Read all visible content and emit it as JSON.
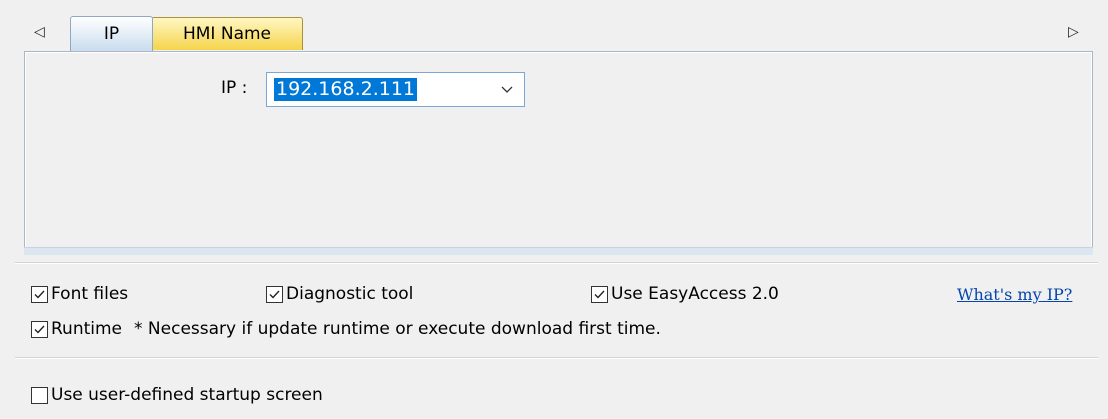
{
  "tabs": [
    {
      "label": "IP",
      "active": true
    },
    {
      "label": "HMI Name",
      "active": false
    }
  ],
  "ip": {
    "label": "IP :",
    "value": "192.168.2.111"
  },
  "options": {
    "font_files": {
      "label": "Font files",
      "checked": true
    },
    "diagnostic_tool": {
      "label": "Diagnostic tool",
      "checked": true
    },
    "easyaccess": {
      "label": "Use EasyAccess 2.0",
      "checked": true
    },
    "runtime": {
      "label": "Runtime",
      "checked": true
    },
    "runtime_note": "* Necessary if update runtime or execute download first time."
  },
  "link": {
    "label": "What's my IP?"
  },
  "startup": {
    "label": "Use user-defined startup screen",
    "checked": false
  },
  "colors": {
    "selection": "#0078d7",
    "link": "#0645ad",
    "active_tab": "#c9dcee",
    "inactive_tab": "#f5d44c"
  }
}
